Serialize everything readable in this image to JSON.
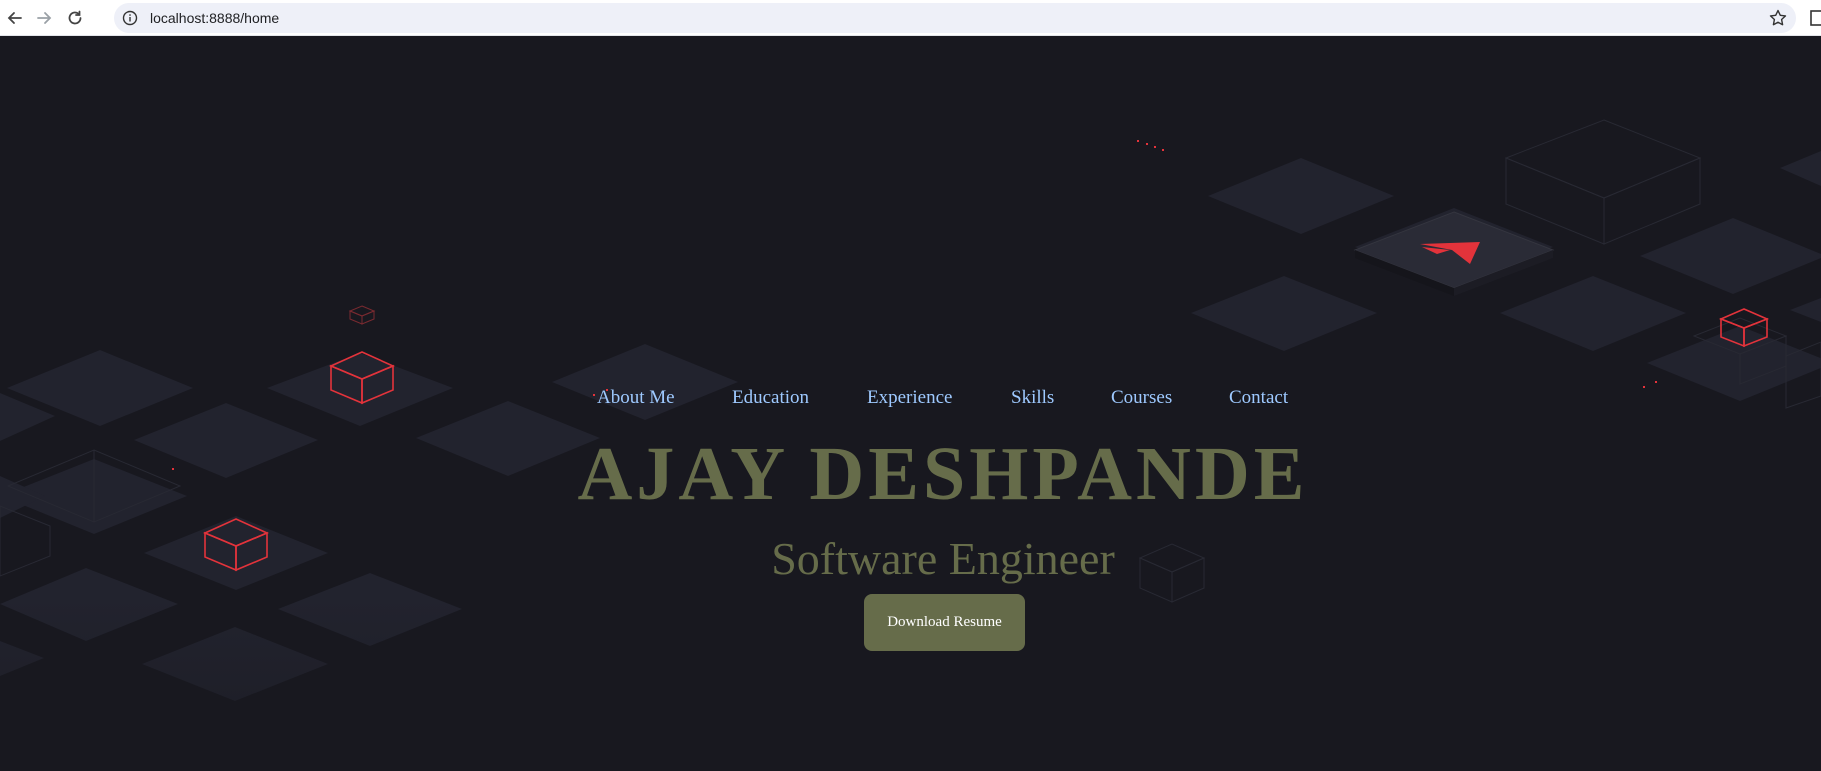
{
  "browser": {
    "url": "localhost:8888/home",
    "icons": [
      "back-arrow-icon",
      "forward-arrow-icon",
      "reload-icon",
      "info-icon",
      "bookmark-star-icon",
      "side-panel-icon"
    ]
  },
  "nav": {
    "items": [
      {
        "label": "About Me"
      },
      {
        "label": "Education"
      },
      {
        "label": "Experience"
      },
      {
        "label": "Skills"
      },
      {
        "label": "Courses"
      },
      {
        "label": "Contact"
      }
    ]
  },
  "hero": {
    "name": "AJAY DESHPANDE",
    "title": "Software Engineer",
    "button_label": "Download Resume"
  },
  "colors": {
    "background": "#18181f",
    "tile": "#22232e",
    "cube_accent": "#e3333b",
    "nav_link": "#9ec9ff",
    "hero_text": "#666c4a",
    "button_bg": "#666c4a",
    "button_text": "#ffffff"
  }
}
